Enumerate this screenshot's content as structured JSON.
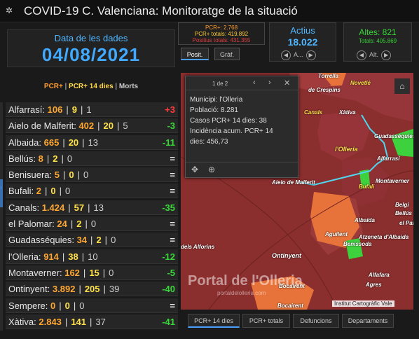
{
  "header": {
    "title": "COVID-19 C. Valenciana: Monitoratge de la situació",
    "logo_icon": "virus-icon"
  },
  "date_panel": {
    "label": "Data de les dades",
    "value": "04/08/2021"
  },
  "pcr_box": {
    "line1": "PCR+: 2.768",
    "line2": "PCR+ totals: 419.892",
    "line3": "Positius totals: 431.355"
  },
  "view_buttons": [
    "Posit.",
    "Gràf."
  ],
  "actius": {
    "label": "Actius",
    "value": "18.022",
    "nav": "A..."
  },
  "altes": {
    "label": "Altes: 821",
    "sub": "Totals: 405.869",
    "nav": "Alt."
  },
  "legend": {
    "a": "PCR+",
    "b": "PCR+ 14 dies",
    "c": "Morts",
    "sep": "|"
  },
  "municipalities": [
    {
      "name": "Alfarrasí:",
      "pcr": "106",
      "pcr14": "9",
      "morts": "1",
      "delta": "+3",
      "trend": "up"
    },
    {
      "name": "Aielo de Malferit:",
      "pcr": "402",
      "pcr14": "20",
      "morts": "5",
      "delta": "-3",
      "trend": "down"
    },
    {
      "name": "Albaida:",
      "pcr": "665",
      "pcr14": "20",
      "morts": "13",
      "delta": "-11",
      "trend": "down"
    },
    {
      "name": "Bellús:",
      "pcr": "8",
      "pcr14": "2",
      "morts": "0",
      "delta": "=",
      "trend": "eq"
    },
    {
      "name": "Benisuera:",
      "pcr": "5",
      "pcr14": "0",
      "morts": "0",
      "delta": "=",
      "trend": "eq"
    },
    {
      "name": "Bufali:",
      "pcr": "2",
      "pcr14": "0",
      "morts": "0",
      "delta": "=",
      "trend": "eq"
    },
    {
      "name": "Canals:",
      "pcr": "1.424",
      "pcr14": "57",
      "morts": "13",
      "delta": "-35",
      "trend": "down"
    },
    {
      "name": "el Palomar:",
      "pcr": "24",
      "pcr14": "2",
      "morts": "0",
      "delta": "=",
      "trend": "eq"
    },
    {
      "name": "Guadasséquies:",
      "pcr": "34",
      "pcr14": "2",
      "morts": "0",
      "delta": "=",
      "trend": "eq"
    },
    {
      "name": "l'Olleria:",
      "pcr": "914",
      "pcr14": "38",
      "morts": "10",
      "delta": "-12",
      "trend": "down"
    },
    {
      "name": "Montaverner:",
      "pcr": "162",
      "pcr14": "15",
      "morts": "0",
      "delta": "-5",
      "trend": "down"
    },
    {
      "name": "Ontinyent:",
      "pcr": "3.892",
      "pcr14": "205",
      "morts": "39",
      "delta": "-40",
      "trend": "down"
    },
    {
      "name": "Sempere:",
      "pcr": "0",
      "pcr14": "0",
      "morts": "0",
      "delta": "=",
      "trend": "eq"
    },
    {
      "name": "Xàtiva:",
      "pcr": "2.843",
      "pcr14": "141",
      "morts": "37",
      "delta": "-41",
      "trend": "down"
    }
  ],
  "popup": {
    "page": "1 de 2",
    "line1": "Municipi: l'Olleria",
    "line2": "Població: 8.281",
    "line3": "Casos PCR+ 14 dies: 38",
    "line4": "Incidència acum. PCR+ 14",
    "line5": "dies: 456,73"
  },
  "map": {
    "labels": [
      "Torrella",
      "de Crespins",
      "Novetlé",
      "Canals",
      "Xàtiva",
      "Guadasséquies",
      "l'Olleria",
      "Alfarrasí",
      "Aielo de Malferit",
      "Montaverner",
      "Bufali",
      "Belgi",
      "Albaida",
      "Bellús",
      "Aguilent",
      "Benissoda",
      "Atzeneta d'Albaida",
      "el Palomar",
      "Ontinyent",
      "dels Alforins",
      "Bocairent",
      "Agres",
      "Alfafara",
      "Bocairent"
    ],
    "copyright": "Institut Cartogràfic Vale",
    "watermark": "Portal de l'Olleria",
    "watermark_sub": "portaldelolleria.com"
  },
  "map_tabs": [
    "PCR+ 14 dies",
    "PCR+ totals",
    "Defuncions",
    "Departaments"
  ],
  "colors": {
    "accent": "#41aaff",
    "up": "#ff3b3b",
    "down": "#39d839",
    "map_base": "#8b2e2e",
    "map_orange": "#e8733a",
    "map_green": "#3ed13e"
  }
}
